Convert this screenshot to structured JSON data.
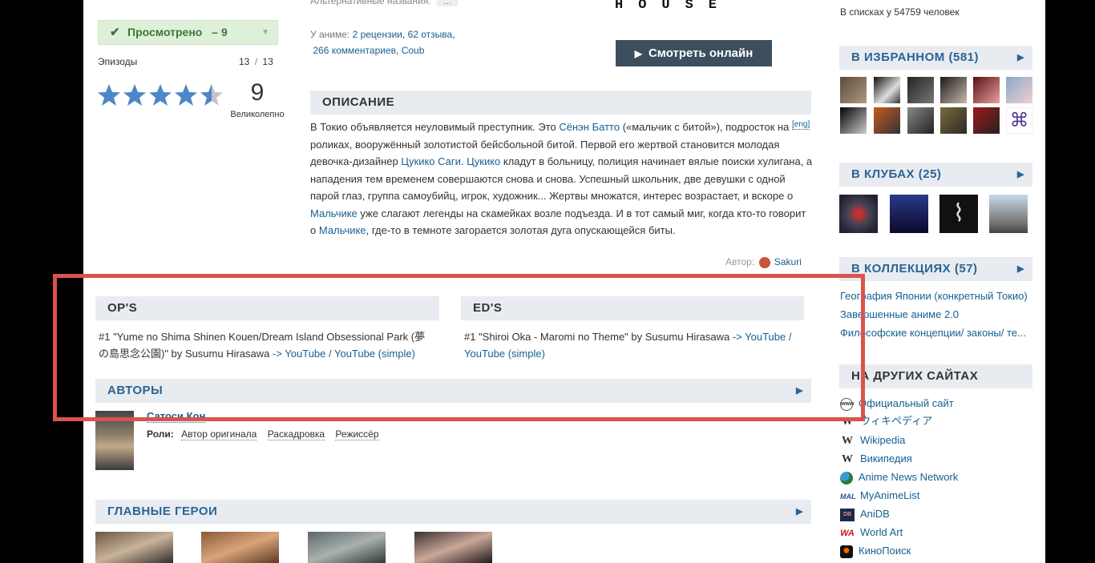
{
  "left": {
    "watched_label": "Просмотрено",
    "watched_sep": "–",
    "watched_count": "9",
    "episodes_label": "Эпизоды",
    "episodes_value": "13",
    "episodes_sep": "/",
    "episodes_total": "13",
    "score": "9",
    "score_text": "Великолепно"
  },
  "info": {
    "alt_names": "Альтернативные названия:",
    "alt_more": "...",
    "about_label": "У аниме:",
    "reviews": "2 рецензии",
    "comma": ",",
    "feedback": "62 отзыва",
    "comments": "266 комментариев",
    "coub": "Coub"
  },
  "studio_logo": "HOUSE",
  "watch_button": "Смотреть онлайн",
  "description": {
    "title": "ОПИСАНИЕ",
    "eng": "[eng]",
    "p1": "В Токио объявляется неуловимый преступник. Это ",
    "l1": "Сёнэн Батто",
    "p2": " («мальчик с битой»), подросток на роликах, вооружённый золотистой бейсбольной битой. Первой его жертвой становится молодая девочка-дизайнер ",
    "l2": "Цукико Саги",
    "p3": ". ",
    "l3": "Цукико",
    "p4": " кладут в больницу, полиция начинает вялые поиски хулигана, а нападения тем временем совершаются снова и снова. Успешный школьник, две девушки с одной парой глаз, группа самоубийц, игрок, художник... Жертвы множатся, интерес возрастает, и вскоре о ",
    "l4": "Мальчике",
    "p5": " уже слагают легенды на скамейках возле подъезда. И в тот самый миг, когда кто-то говорит о ",
    "l5": "Мальчике",
    "p6": ", где-то в темноте загорается золотая дуга опускающейся биты.",
    "author_label": "Автор:",
    "author": "Sakuri"
  },
  "ops": {
    "title": "OP'S",
    "line1": "#1 \"Yume no Shima Shinen Kouen/Dream Island Obsessional Park (夢",
    "line2": "の島思念公園)\" by Susumu Hirasawa ",
    "links": "-> YouTube / YouTube (simple)"
  },
  "eds": {
    "title": "ED'S",
    "line1": "#1 \"Shiroi Oka - Maromi no Theme\" by Susumu Hirasawa ",
    "link1": "-> YouTube /",
    "link2": "YouTube (simple)"
  },
  "authors": {
    "title": "АВТОРЫ",
    "name": "Сатоси Кон",
    "roles_label": "Роли:",
    "roles": [
      "Автор оригинала",
      "Раскадровка",
      "Режиссёр"
    ]
  },
  "main_chars": {
    "title": "ГЛАВНЫЕ ГЕРОИ"
  },
  "sidebar": {
    "in_lists": "В списках у 54759 человек",
    "favorites_title": "В ИЗБРАННОМ",
    "favorites_count": "(581)",
    "clubs_title": "В КЛУБАХ",
    "clubs_count": "(25)",
    "collections_title": "В КОЛЛЕКЦИЯХ",
    "collections_count": "(57)",
    "collections": [
      "География Японии (конкретный Токио)",
      "Завершенные аниме 2.0",
      "Философские концепции/ законы/ те..."
    ],
    "other_sites_title": "НА ДРУГИХ САЙТАХ",
    "sites": [
      "Официальный сайт",
      "ウィキペディア",
      "Wikipedia",
      "Википедия",
      "Anime News Network",
      "MyAnimeList",
      "AniDB",
      "World Art",
      "КиноПоиск"
    ]
  },
  "colors": {
    "accent": "#176093",
    "highlight": "#d9534f",
    "watched_bg": "#dff0d8",
    "watched_text": "#3c763d",
    "button_bg": "#3d4f5e"
  }
}
